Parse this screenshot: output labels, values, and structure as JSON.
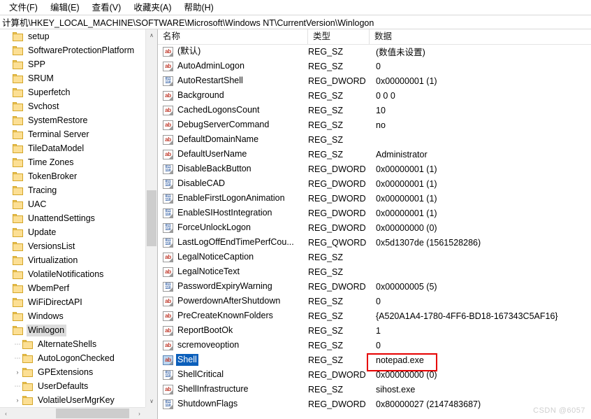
{
  "menu": {
    "items": [
      {
        "label": "文件(F)",
        "name": "menu-file"
      },
      {
        "label": "编辑(E)",
        "name": "menu-edit"
      },
      {
        "label": "查看(V)",
        "name": "menu-view"
      },
      {
        "label": "收藏夹(A)",
        "name": "menu-favorites"
      },
      {
        "label": "帮助(H)",
        "name": "menu-help"
      }
    ]
  },
  "address": {
    "path": "计算机\\HKEY_LOCAL_MACHINE\\SOFTWARE\\Microsoft\\Windows NT\\CurrentVersion\\Winlogon"
  },
  "tree": {
    "items": [
      {
        "label": "setup",
        "expander": "",
        "indent": 0,
        "selected": false
      },
      {
        "label": "SoftwareProtectionPlatform",
        "expander": "",
        "indent": 0,
        "selected": false
      },
      {
        "label": "SPP",
        "expander": "",
        "indent": 0,
        "selected": false
      },
      {
        "label": "SRUM",
        "expander": "",
        "indent": 0,
        "selected": false
      },
      {
        "label": "Superfetch",
        "expander": "",
        "indent": 0,
        "selected": false
      },
      {
        "label": "Svchost",
        "expander": "",
        "indent": 0,
        "selected": false
      },
      {
        "label": "SystemRestore",
        "expander": "",
        "indent": 0,
        "selected": false
      },
      {
        "label": "Terminal Server",
        "expander": "",
        "indent": 0,
        "selected": false
      },
      {
        "label": "TileDataModel",
        "expander": "",
        "indent": 0,
        "selected": false
      },
      {
        "label": "Time Zones",
        "expander": "",
        "indent": 0,
        "selected": false
      },
      {
        "label": "TokenBroker",
        "expander": "",
        "indent": 0,
        "selected": false
      },
      {
        "label": "Tracing",
        "expander": "",
        "indent": 0,
        "selected": false
      },
      {
        "label": "UAC",
        "expander": "",
        "indent": 0,
        "selected": false
      },
      {
        "label": "UnattendSettings",
        "expander": "",
        "indent": 0,
        "selected": false
      },
      {
        "label": "Update",
        "expander": "",
        "indent": 0,
        "selected": false
      },
      {
        "label": "VersionsList",
        "expander": "",
        "indent": 0,
        "selected": false
      },
      {
        "label": "Virtualization",
        "expander": "",
        "indent": 0,
        "selected": false
      },
      {
        "label": "VolatileNotifications",
        "expander": "",
        "indent": 0,
        "selected": false
      },
      {
        "label": "WbemPerf",
        "expander": "",
        "indent": 0,
        "selected": false
      },
      {
        "label": "WiFiDirectAPI",
        "expander": "",
        "indent": 0,
        "selected": false
      },
      {
        "label": "Windows",
        "expander": "",
        "indent": 0,
        "selected": false
      },
      {
        "label": "Winlogon",
        "expander": "",
        "indent": 0,
        "selected": true
      },
      {
        "label": "AlternateShells",
        "expander": "dash",
        "indent": 1,
        "selected": false
      },
      {
        "label": "AutoLogonChecked",
        "expander": "dash",
        "indent": 1,
        "selected": false
      },
      {
        "label": "GPExtensions",
        "expander": "collapsed",
        "indent": 1,
        "selected": false
      },
      {
        "label": "UserDefaults",
        "expander": "dash",
        "indent": 1,
        "selected": false
      },
      {
        "label": "VolatileUserMgrKey",
        "expander": "collapsed",
        "indent": 1,
        "selected": false
      }
    ]
  },
  "list": {
    "columns": {
      "name": "名称",
      "type": "类型",
      "data": "数据"
    },
    "rows": [
      {
        "name": "(默认)",
        "icon": "string-value-icon",
        "type": "REG_SZ",
        "data": "(数值未设置)",
        "selected": false
      },
      {
        "name": "AutoAdminLogon",
        "icon": "string-value-icon",
        "type": "REG_SZ",
        "data": "0",
        "selected": false
      },
      {
        "name": "AutoRestartShell",
        "icon": "dword-value-icon",
        "type": "REG_DWORD",
        "data": "0x00000001 (1)",
        "selected": false
      },
      {
        "name": "Background",
        "icon": "string-value-icon",
        "type": "REG_SZ",
        "data": "0 0 0",
        "selected": false
      },
      {
        "name": "CachedLogonsCount",
        "icon": "string-value-icon",
        "type": "REG_SZ",
        "data": "10",
        "selected": false
      },
      {
        "name": "DebugServerCommand",
        "icon": "string-value-icon",
        "type": "REG_SZ",
        "data": "no",
        "selected": false
      },
      {
        "name": "DefaultDomainName",
        "icon": "string-value-icon",
        "type": "REG_SZ",
        "data": "",
        "selected": false
      },
      {
        "name": "DefaultUserName",
        "icon": "string-value-icon",
        "type": "REG_SZ",
        "data": "Administrator",
        "selected": false
      },
      {
        "name": "DisableBackButton",
        "icon": "dword-value-icon",
        "type": "REG_DWORD",
        "data": "0x00000001 (1)",
        "selected": false
      },
      {
        "name": "DisableCAD",
        "icon": "dword-value-icon",
        "type": "REG_DWORD",
        "data": "0x00000001 (1)",
        "selected": false
      },
      {
        "name": "EnableFirstLogonAnimation",
        "icon": "dword-value-icon",
        "type": "REG_DWORD",
        "data": "0x00000001 (1)",
        "selected": false
      },
      {
        "name": "EnableSIHostIntegration",
        "icon": "dword-value-icon",
        "type": "REG_DWORD",
        "data": "0x00000001 (1)",
        "selected": false
      },
      {
        "name": "ForceUnlockLogon",
        "icon": "dword-value-icon",
        "type": "REG_DWORD",
        "data": "0x00000000 (0)",
        "selected": false
      },
      {
        "name": "LastLogOffEndTimePerfCou...",
        "icon": "dword-value-icon",
        "type": "REG_QWORD",
        "data": "0x5d1307de (1561528286)",
        "selected": false
      },
      {
        "name": "LegalNoticeCaption",
        "icon": "string-value-icon",
        "type": "REG_SZ",
        "data": "",
        "selected": false
      },
      {
        "name": "LegalNoticeText",
        "icon": "string-value-icon",
        "type": "REG_SZ",
        "data": "",
        "selected": false
      },
      {
        "name": "PasswordExpiryWarning",
        "icon": "dword-value-icon",
        "type": "REG_DWORD",
        "data": "0x00000005 (5)",
        "selected": false
      },
      {
        "name": "PowerdownAfterShutdown",
        "icon": "string-value-icon",
        "type": "REG_SZ",
        "data": "0",
        "selected": false
      },
      {
        "name": "PreCreateKnownFolders",
        "icon": "string-value-icon",
        "type": "REG_SZ",
        "data": "{A520A1A4-1780-4FF6-BD18-167343C5AF16}",
        "selected": false
      },
      {
        "name": "ReportBootOk",
        "icon": "string-value-icon",
        "type": "REG_SZ",
        "data": "1",
        "selected": false
      },
      {
        "name": "scremoveoption",
        "icon": "string-value-icon",
        "type": "REG_SZ",
        "data": "0",
        "selected": false
      },
      {
        "name": "Shell",
        "icon": "string-value-icon",
        "type": "REG_SZ",
        "data": "notepad.exe",
        "selected": true
      },
      {
        "name": "ShellCritical",
        "icon": "dword-value-icon",
        "type": "REG_DWORD",
        "data": "0x00000000 (0)",
        "selected": false
      },
      {
        "name": "ShellInfrastructure",
        "icon": "string-value-icon",
        "type": "REG_SZ",
        "data": "sihost.exe",
        "selected": false
      },
      {
        "name": "ShutdownFlags",
        "icon": "dword-value-icon",
        "type": "REG_DWORD",
        "data": "0x80000027 (2147483687)",
        "selected": false
      }
    ]
  },
  "highlight": {
    "target_value": "notepad.exe",
    "color": "#e60000"
  },
  "watermark": {
    "text": "CSDN @6057"
  },
  "scroll": {
    "tree_up_arrow": "∧",
    "tree_down_arrow": "∨",
    "left_arrow": "‹",
    "right_arrow": "›"
  }
}
